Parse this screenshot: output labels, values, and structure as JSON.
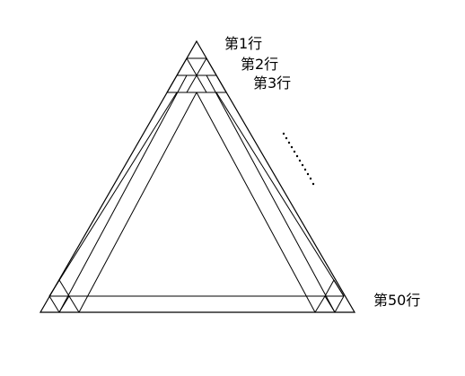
{
  "labels": {
    "row1": "第1行",
    "row2": "第2行",
    "row3": "第3行",
    "row50": "第50行"
  }
}
